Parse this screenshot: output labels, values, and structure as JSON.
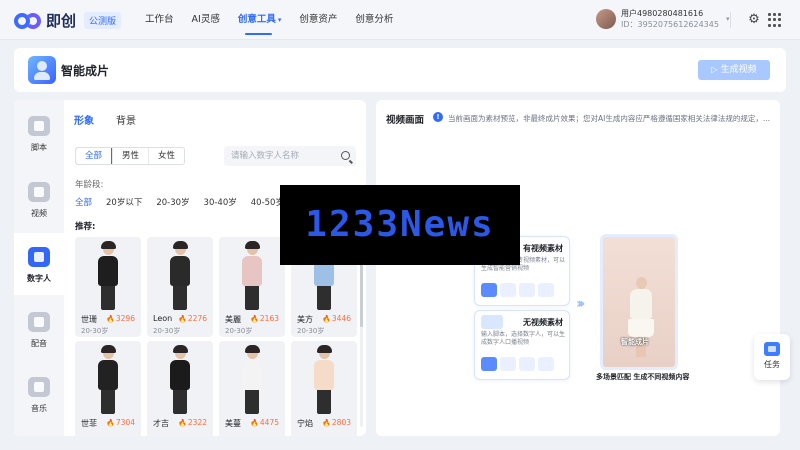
{
  "brand": {
    "name": "即创",
    "badge": "公测版"
  },
  "nav": {
    "items": [
      {
        "label": "工作台"
      },
      {
        "label": "AI灵感"
      },
      {
        "label": "创意工具",
        "active": true
      },
      {
        "label": "创意资产"
      },
      {
        "label": "创意分析"
      }
    ],
    "caret": "▾"
  },
  "user": {
    "name": "用户4980280481616",
    "id": "ID：3952075612624345"
  },
  "header": {
    "title": "智能成片",
    "generate_button": "生成视频"
  },
  "sidebar": {
    "items": [
      {
        "label": "脚本",
        "icon": "script-icon"
      },
      {
        "label": "视频",
        "icon": "video-icon"
      },
      {
        "label": "数字人",
        "icon": "digital-human-icon",
        "active": true
      },
      {
        "label": "配音",
        "icon": "voice-icon"
      },
      {
        "label": "音乐",
        "icon": "music-icon"
      }
    ]
  },
  "panel": {
    "tabs": [
      {
        "label": "形象",
        "active": true
      },
      {
        "label": "背景"
      }
    ],
    "gender": [
      "全部",
      "男性",
      "女性"
    ],
    "search_placeholder": "请输入数字人名称",
    "age_label": "年龄段:",
    "ages": [
      "全部",
      "20岁以下",
      "20-30岁",
      "30-40岁",
      "40-50岁"
    ],
    "recommend_label": "推荐:",
    "cards": [
      {
        "name": "世珊",
        "likes": "3296",
        "age": "20-30岁",
        "outfit": "#1e1e1e"
      },
      {
        "name": "Leon",
        "likes": "2276",
        "age": "20-30岁",
        "outfit": "#2a2a2a"
      },
      {
        "name": "美麗",
        "likes": "2163",
        "age": "20-30岁",
        "outfit": "#e6c5c2"
      },
      {
        "name": "美方",
        "likes": "3446",
        "age": "20-30岁",
        "outfit": "#9fc0e6"
      },
      {
        "name": "世菲",
        "likes": "7304",
        "age": "",
        "outfit": "#222222"
      },
      {
        "name": "才吉",
        "likes": "2322",
        "age": "",
        "outfit": "#1b1b1b"
      },
      {
        "name": "美蔓",
        "likes": "4475",
        "age": "",
        "outfit": "#f3f3f3"
      },
      {
        "name": "宁焰",
        "likes": "2803",
        "age": "",
        "outfit": "#f5dcc9"
      }
    ]
  },
  "preview": {
    "title": "视频画面",
    "note": "当前画面为素材预览，非最终成片效果；您对AI生成内容应严格遵循国家相关法律法规的规定，...",
    "box1": {
      "title": "有视频素材",
      "desc": "输入脚本，上传视频素材，可以生成智能营销视频"
    },
    "box2": {
      "title": "无视频素材",
      "desc": "输入脚本，选择数字人，可以生成数字人口播视频"
    },
    "phone_caption": "智能成片",
    "caption": "多场景匹配 生成不同视频内容"
  },
  "task": {
    "label": "任务"
  },
  "watermark": {
    "text": "1233News"
  }
}
